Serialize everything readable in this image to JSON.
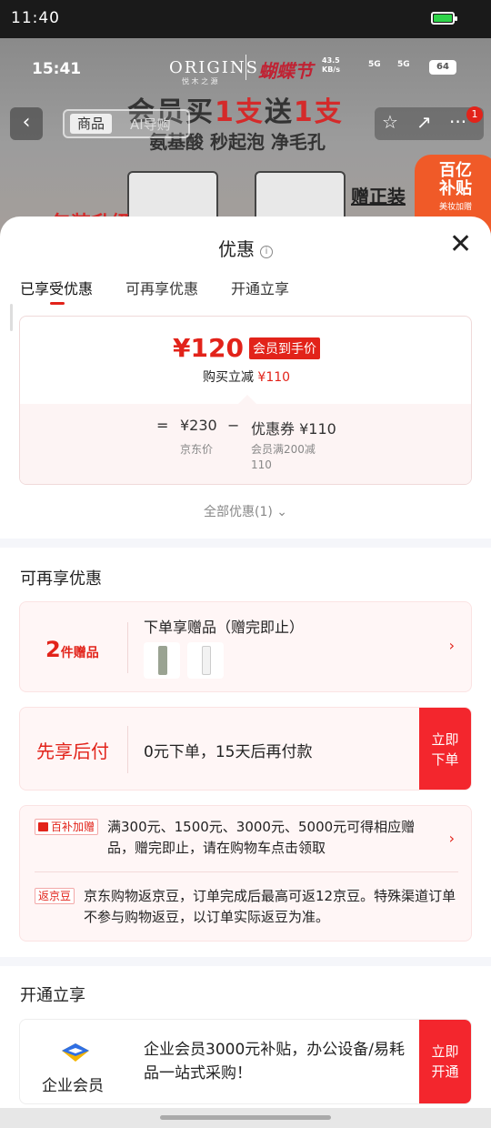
{
  "outer_status": {
    "time": "11:40"
  },
  "background": {
    "inner_time": "15:41",
    "brand": "ORIGINS",
    "brand_sub": "悦 木 之 源",
    "festival": "蝴蝶节",
    "speed": "43.5\nKB/s",
    "signal_1": "5G",
    "signal_2": "5G",
    "battery": "64",
    "promo_title_a": "会员买",
    "promo_title_b": "1支",
    "promo_title_c": "送",
    "promo_title_d": "1支",
    "promo_sub": "氨基酸 秒起泡 净毛孔",
    "nav_tab_goods": "商品",
    "nav_tab_ai": "AI导购",
    "cart_badge": "1",
    "gift_tag": "赠正装",
    "subsidy_a": "百亿\n补贴",
    "subsidy_b": "美妆加赠",
    "red_text": "包装升级"
  },
  "sheet": {
    "title": "优惠",
    "tabs": [
      "已享受优惠",
      "可再享优惠",
      "开通立享"
    ],
    "price_card": {
      "price": "¥120",
      "price_tag": "会员到手价",
      "sub_prefix": "购买立减",
      "sub_amount": "¥110",
      "eq": "=",
      "jd_price": "¥230",
      "minus": "−",
      "coupon": "优惠券 ¥110",
      "jd_price_label": "京东价",
      "coupon_label": "会员满200减\n110"
    },
    "all_deals": "全部优惠(1)",
    "section_more": "可再享优惠",
    "gift_card": {
      "count": "2",
      "count_unit": "件赠品",
      "title": "下单享赠品（赠完即止）"
    },
    "paylater_card": {
      "title": "先享后付",
      "desc": "0元下单，15天后再付款",
      "action": "立即\n下单"
    },
    "info_card": {
      "tag1": "百补加赠",
      "text1": "满300元、1500元、3000元、5000元可得相应赠品，赠完即止，请在购物车点击领取",
      "tag2": "返京豆",
      "text2": "京东购物返京豆，订单完成后最高可返12京豆。特殊渠道订单不参与购物返豆，以订单实际返豆为准。"
    },
    "section_open": "开通立享",
    "enterprise_card": {
      "label": "企业会员",
      "desc": "企业会员3000元补贴，办公设备/易耗品一站式采购！",
      "action": "立即\n开通"
    }
  },
  "colors": {
    "accent": "#e2231a",
    "action": "#f3262d",
    "pink_bg": "#fff6f6"
  }
}
